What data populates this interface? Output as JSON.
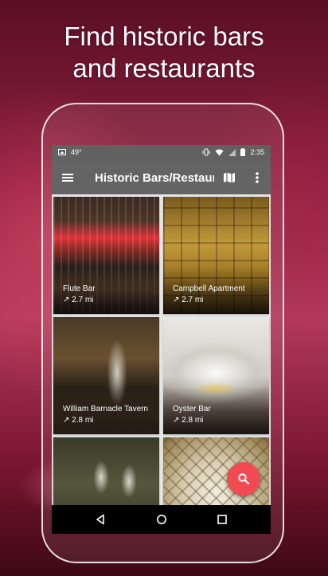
{
  "headline": {
    "line1": "Find historic bars",
    "line2": "and restaurants"
  },
  "status_bar": {
    "temperature": "49°",
    "time": "2:35"
  },
  "toolbar": {
    "title": "Historic Bars/Restaurants"
  },
  "places": [
    {
      "name": "Flute Bar",
      "distance": "↗ 2.7 mi"
    },
    {
      "name": "Campbell Apartment",
      "distance": "↗ 2.7 mi"
    },
    {
      "name": "William Barnacle Tavern",
      "distance": "↗ 2.8 mi"
    },
    {
      "name": "Oyster Bar",
      "distance": "↗ 2.8 mi"
    },
    {
      "name": "",
      "distance": ""
    },
    {
      "name": "",
      "distance": ""
    }
  ],
  "icons": {
    "menu": "menu-icon",
    "map": "map-icon",
    "more": "more-vert-icon",
    "search": "search-icon",
    "back": "back-icon",
    "home": "home-icon",
    "recents": "recents-icon"
  },
  "colors": {
    "fab": "#f04a52",
    "toolbar": "#646464",
    "status_bar": "#616161"
  }
}
